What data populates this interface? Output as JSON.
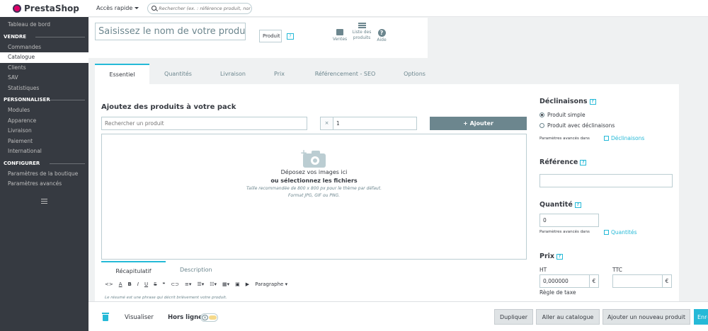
{
  "brand": {
    "name": "PrestaShop"
  },
  "header": {
    "quick_access": "Accès rapide",
    "search_placeholder": "Rechercher (ex. : référence produit, nom"
  },
  "sidebar": {
    "items": [
      {
        "type": "item",
        "label": "Tableau de bord"
      },
      {
        "type": "section",
        "label": "VENDRE"
      },
      {
        "type": "item",
        "label": "Commandes"
      },
      {
        "type": "item",
        "label": "Catalogue",
        "active": true
      },
      {
        "type": "item",
        "label": "Clients"
      },
      {
        "type": "item",
        "label": "SAV"
      },
      {
        "type": "item",
        "label": "Statistiques"
      },
      {
        "type": "section",
        "label": "PERSONNALISER"
      },
      {
        "type": "item",
        "label": "Modules"
      },
      {
        "type": "item",
        "label": "Apparence"
      },
      {
        "type": "item",
        "label": "Livraison"
      },
      {
        "type": "item",
        "label": "Paiement"
      },
      {
        "type": "item",
        "label": "International"
      },
      {
        "type": "section",
        "label": "CONFIGURER"
      },
      {
        "type": "item",
        "label": "Paramètres de la boutique"
      },
      {
        "type": "item",
        "label": "Paramètres avancés"
      }
    ]
  },
  "product": {
    "name_placeholder": "Saisissez le nom de votre produit",
    "type_value": "Produit",
    "help": "?",
    "actions": {
      "sales": "Ventes",
      "list": "Liste des produits",
      "help": "Aide"
    }
  },
  "tabs": [
    "Essentiel",
    "Quantités",
    "Livraison",
    "Prix",
    "Référencement - SEO",
    "Options"
  ],
  "pack": {
    "title": "Ajoutez des produits à votre pack",
    "search_placeholder": "Rechercher un produit",
    "qty_prefix": "×",
    "qty_value": "1",
    "add_button": "Ajouter",
    "add_icon": "+"
  },
  "dropzone": {
    "line1": "Déposez vos images ici",
    "line2": "ou sélectionnez les fichiers",
    "line3": "Taille recommandée de 800 x 800 px pour le thème par défaut.",
    "line4": "Format JPG, GIF ou PNG."
  },
  "description": {
    "tabs": [
      "Récapitulatif",
      "Description"
    ],
    "paragraph_label": "Paragraphe",
    "hint": "Le résumé est une phrase qui décrit brièvement votre produit."
  },
  "right": {
    "declinaisons": {
      "title": "Déclinaisons",
      "simple": "Produit simple",
      "with": "Produit avec déclinaisons",
      "adv": "Paramètres avancés dans",
      "link": "Déclinaisons"
    },
    "reference": {
      "title": "Référence",
      "value": ""
    },
    "quantity": {
      "title": "Quantité",
      "value": "0",
      "adv": "Paramètres avancés dans",
      "link": "Quantités"
    },
    "price": {
      "title": "Prix",
      "ht_label": "HT",
      "ttc_label": "TTC",
      "ht_value": "0,000000",
      "ttc_value": "",
      "currency": "€",
      "tax_rule": "Règle de taxe"
    }
  },
  "footer": {
    "preview": "Visualiser",
    "offline": "Hors ligne",
    "switch_x": "✕",
    "duplicate": "Dupliquer",
    "go_catalog": "Aller au catalogue",
    "add_new": "Ajouter un nouveau produit",
    "save": "Enregistrer"
  },
  "colors": {
    "accent": "#25b9d7",
    "sidebar": "#363a41",
    "button_gray": "#6c868e"
  }
}
